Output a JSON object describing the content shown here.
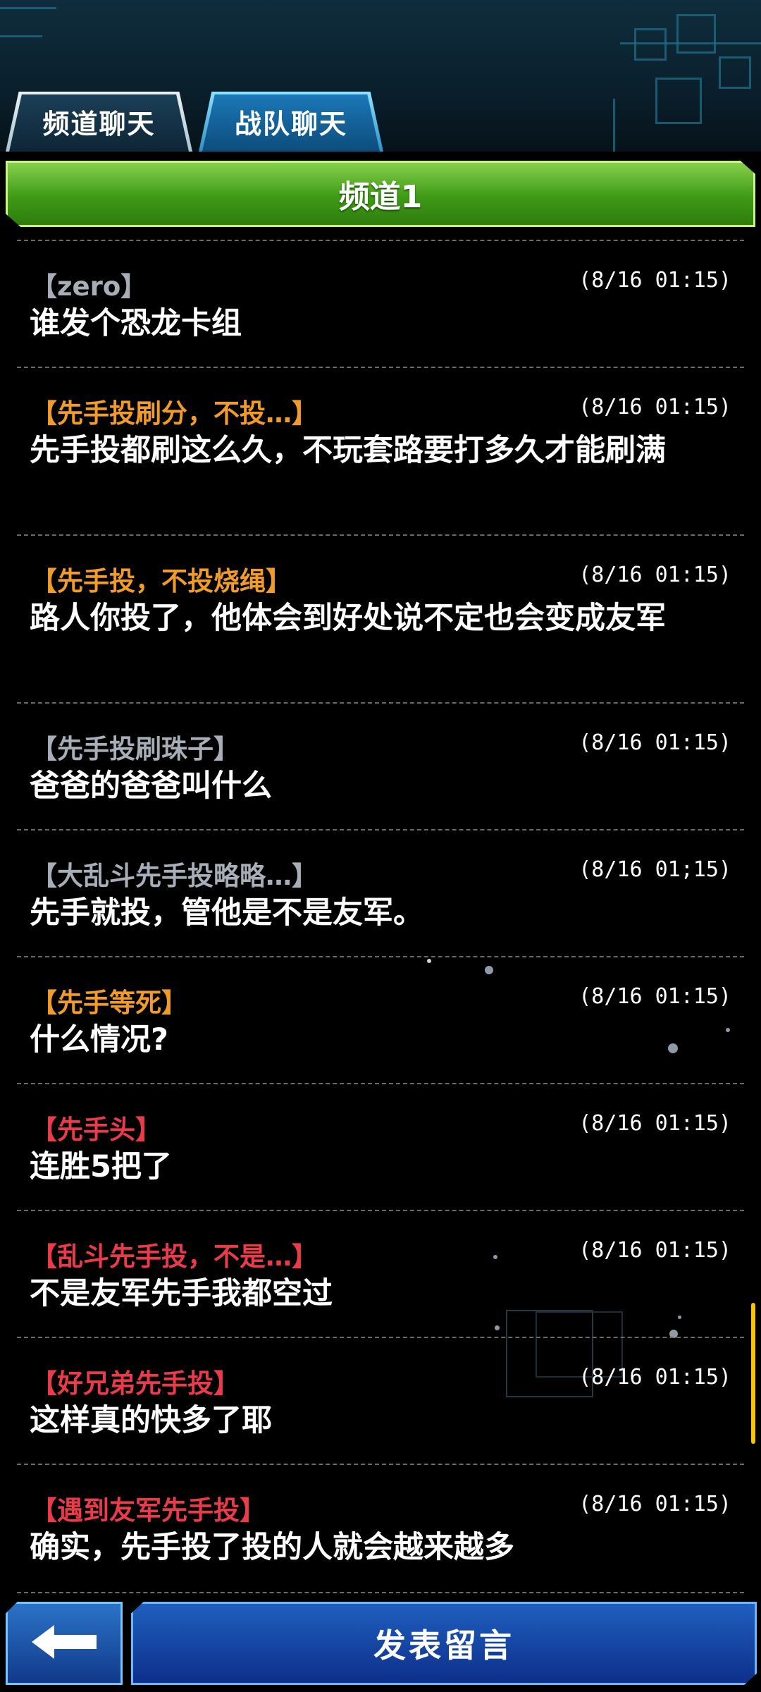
{
  "tabs": [
    {
      "label": "频道聊天",
      "active": true
    },
    {
      "label": "战队聊天",
      "active": false
    }
  ],
  "channel": {
    "title": "频道1",
    "color": "#3f9a17"
  },
  "messages": [
    {
      "name": "【zero】",
      "name_color": "#a7aeb8",
      "time": "(8/16 01:15)",
      "text": "谁发个恐龙卡组"
    },
    {
      "name": "【先手投刷分，不投…】",
      "name_color": "#f09b2a",
      "time": "(8/16 01:15)",
      "text": "先手投都刷这么久，不玩套路要打多久才能刷满"
    },
    {
      "name": "【先手投，不投烧绳】",
      "name_color": "#f09b2a",
      "time": "(8/16 01:15)",
      "text": "路人你投了，他体会到好处说不定也会变成友军"
    },
    {
      "name": "【先手投刷珠子】",
      "name_color": "#a7aeb8",
      "time": "(8/16 01:15)",
      "text": "爸爸的爸爸叫什么"
    },
    {
      "name": "【大乱斗先手投略略…】",
      "name_color": "#a7aeb8",
      "time": "(8/16 01;15)",
      "text": "先手就投，管他是不是友军。"
    },
    {
      "name": "【先手等死】",
      "name_color": "#f09b2a",
      "time": "(8/16 01:15)",
      "text": "什么情况?"
    },
    {
      "name": "【先手头】",
      "name_color": "#ea3b4b",
      "time": "(8/16 01:15)",
      "text": "连胜5把了"
    },
    {
      "name": "【乱斗先手投，不是…】",
      "name_color": "#ea3b4b",
      "time": "(8/16 01:15)",
      "text": "不是友军先手我都空过"
    },
    {
      "name": "【好兄弟先手投】",
      "name_color": "#ea3b4b",
      "time": "(8/16 01:15)",
      "text": "这样真的快多了耶"
    },
    {
      "name": "【遇到友军先手投】",
      "name_color": "#ea3b4b",
      "time": "(8/16 01:15)",
      "text": "确实，先手投了投的人就会越来越多"
    }
  ],
  "bottom": {
    "back_icon": "back-arrow-icon",
    "post_label": "发表留言"
  },
  "scrollbar_color": "#f4c500"
}
